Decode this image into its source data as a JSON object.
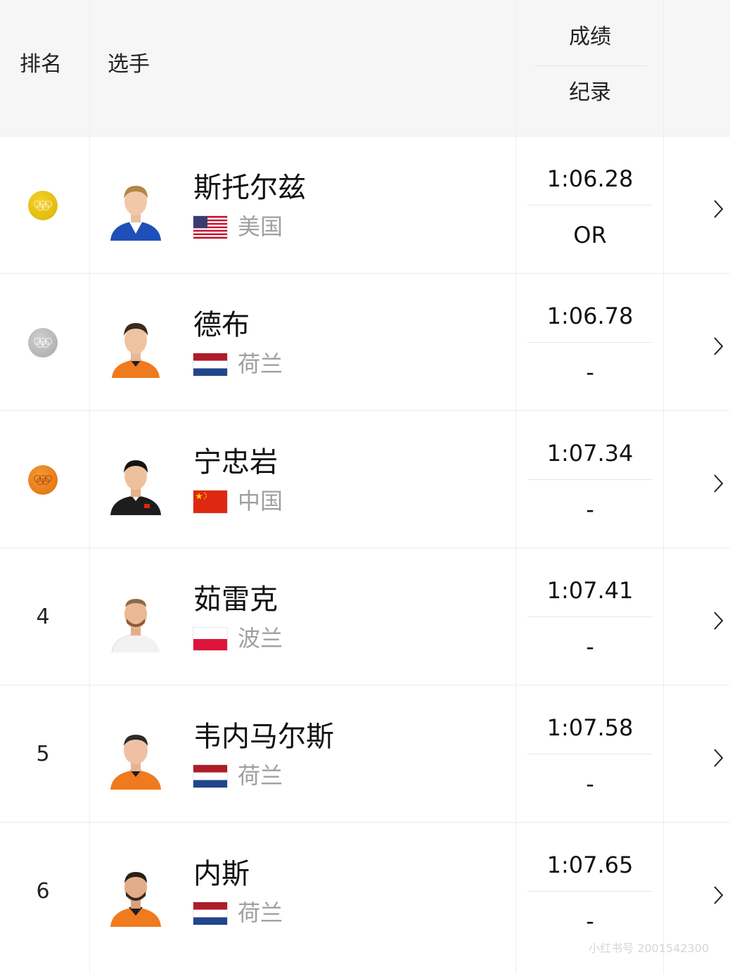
{
  "header": {
    "rank_label": "排名",
    "athlete_label": "选手",
    "result_label": "成绩",
    "record_label": "纪录"
  },
  "rows": [
    {
      "rank": "",
      "medal": "gold",
      "name": "斯托尔兹",
      "country": "美国",
      "flag": "usa",
      "time": "1:06.28",
      "record": "OR"
    },
    {
      "rank": "",
      "medal": "silver",
      "name": "德布",
      "country": "荷兰",
      "flag": "netherlands",
      "time": "1:06.78",
      "record": "-"
    },
    {
      "rank": "",
      "medal": "bronze",
      "name": "宁忠岩",
      "country": "中国",
      "flag": "china",
      "time": "1:07.34",
      "record": "-"
    },
    {
      "rank": "4",
      "medal": "",
      "name": "茹雷克",
      "country": "波兰",
      "flag": "poland",
      "time": "1:07.41",
      "record": "-"
    },
    {
      "rank": "5",
      "medal": "",
      "name": "韦内马尔斯",
      "country": "荷兰",
      "flag": "netherlands",
      "time": "1:07.58",
      "record": "-"
    },
    {
      "rank": "6",
      "medal": "",
      "name": "内斯",
      "country": "荷兰",
      "flag": "netherlands",
      "time": "1:07.65",
      "record": "-"
    }
  ],
  "colors": {
    "gold": "#e8c20f",
    "silver": "#bdbdbd",
    "bronze": "#ee8420",
    "usa_jersey": "#1f4fb8",
    "ned_jersey": "#f07a1e",
    "chn_jersey": "#1d1d1d",
    "pol_jersey": "#f2f2f2"
  },
  "watermark": "小红书号 2001542300"
}
